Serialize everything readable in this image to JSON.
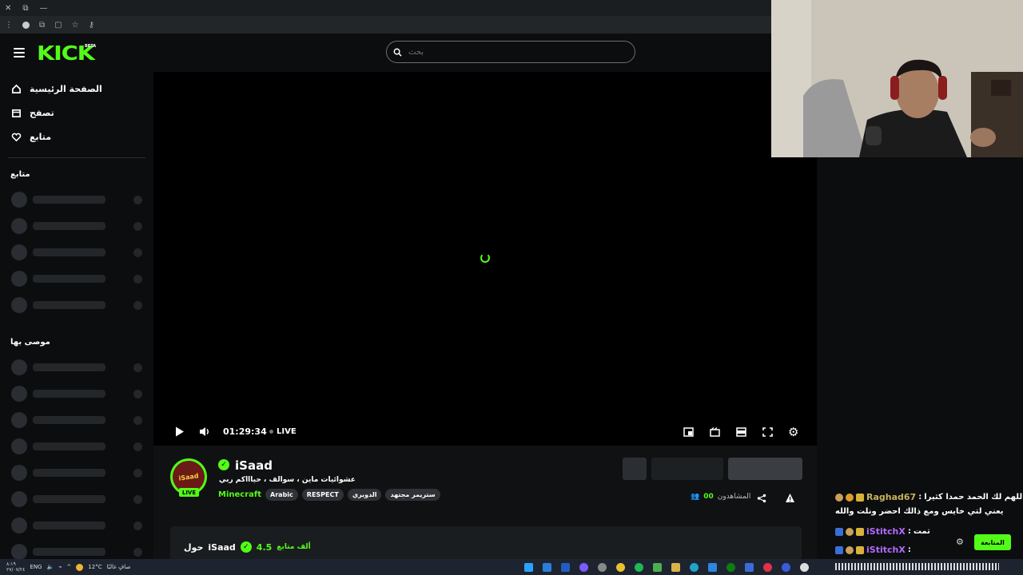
{
  "window_bar": {
    "close": "✕",
    "restore": "⧉",
    "minimize": "—"
  },
  "header": {
    "logo": "KICK",
    "logo_badge": "BETA",
    "search_placeholder": "بحث"
  },
  "sidebar": {
    "nav": [
      {
        "label": "الصفحة الرئيسية",
        "icon": "home-icon"
      },
      {
        "label": "تصفح",
        "icon": "browse-icon"
      },
      {
        "label": "متابع",
        "icon": "heart-icon"
      }
    ],
    "following_heading": "متابع",
    "recommended_heading": "موصى بها"
  },
  "player": {
    "time": "01:29:34",
    "live_label": "LIVE"
  },
  "channel": {
    "avatar_text": "iSaad",
    "live_badge": "LIVE",
    "username": "iSaad",
    "title": "عشوائيات ماين ، سوالف ، حياااكم ربي",
    "category": "Minecraft",
    "tags": [
      "Arabic",
      "RESPECT",
      "الدويري",
      "ستريمر مجتهد"
    ],
    "viewers_count": "00",
    "viewers_label": "المشاهدون",
    "followers_count": "4.5",
    "followers_label": "ألف متابع",
    "about_prefix": "حول",
    "about_name": "iSaad"
  },
  "chat": {
    "lines": [
      {
        "user": "Raghad67",
        "sep": ":",
        "text": "اللهم لك الحمد حمدا كثيرا",
        "user_color": "#c9b25a"
      },
      {
        "user": "",
        "sep": "",
        "text": "يعني لتي خايس ومع ذالك احضر ونلت والله",
        "user_color": "#ffffff"
      },
      {
        "user": "iStitchX",
        "sep": ":",
        "text": "تمت",
        "user_color": "#b36bff"
      },
      {
        "user": "iStitchX",
        "sep": ":",
        "text": "",
        "user_color": "#b36bff"
      }
    ],
    "follow_button": "المتابعة"
  },
  "taskbar": {
    "time": "٨:١٩",
    "date": "٢٧/٠٧/٢٤",
    "lang": "ENG",
    "weather": "12°C",
    "weather_text": "صافٍ غالبًا"
  }
}
